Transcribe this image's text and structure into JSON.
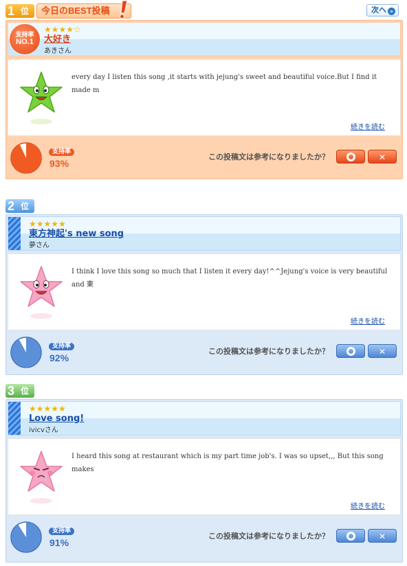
{
  "header": {
    "badge_num": "1",
    "badge_pos": "位",
    "title": "今日のBEST投稿",
    "next_label": "次へ"
  },
  "question": "この投稿文は参考になりましたか？",
  "posts": [
    {
      "rank_num": "1",
      "rank_pos": "位",
      "badge_line1": "支持率",
      "badge_line2": "NO.1",
      "rating": 4.5,
      "stars": "★★★★☆",
      "title": "大好き",
      "author": "あきさん",
      "comment": "every day I listen this song ,it starts with jejung's sweet and beautiful voice.But I find it made m",
      "more": "続きを読む",
      "support_label": "支持率",
      "support_pct": "93%",
      "support_value": 0.93,
      "theme": "orange",
      "avatar": "green-star-icon"
    },
    {
      "rank_num": "2",
      "rank_pos": "位",
      "rating": 5,
      "stars": "★★★★★",
      "title": "東方神起's new song",
      "author": "夢さん",
      "comment": "I think I love this song so much that I listen it every day!^^Jejung's voice is very beautiful and 東",
      "more": "続きを読む",
      "support_label": "支持率",
      "support_pct": "92%",
      "support_value": 0.92,
      "theme": "blue",
      "avatar": "pink-star-icon"
    },
    {
      "rank_num": "3",
      "rank_pos": "位",
      "rating": 5,
      "stars": "★★★★★",
      "title": "Love song!",
      "author": "ivicvさん",
      "comment": "I heard this song at restaurant which is my part time job's. I was so upset,,, But this song makes",
      "more": "続きを読む",
      "support_label": "支持率",
      "support_pct": "91%",
      "support_value": 0.91,
      "theme": "blue",
      "avatar": "pink-star-crying-icon"
    }
  ],
  "colors": {
    "orange_bg": "#ffd3b0",
    "blue_bg": "#dce9f7",
    "orange_accent": "#e85c22",
    "blue_accent": "#3a6fc1",
    "link": "#1b4fa8"
  },
  "vote_yes_icon": "circle-icon",
  "vote_no_icon": "cross-icon"
}
